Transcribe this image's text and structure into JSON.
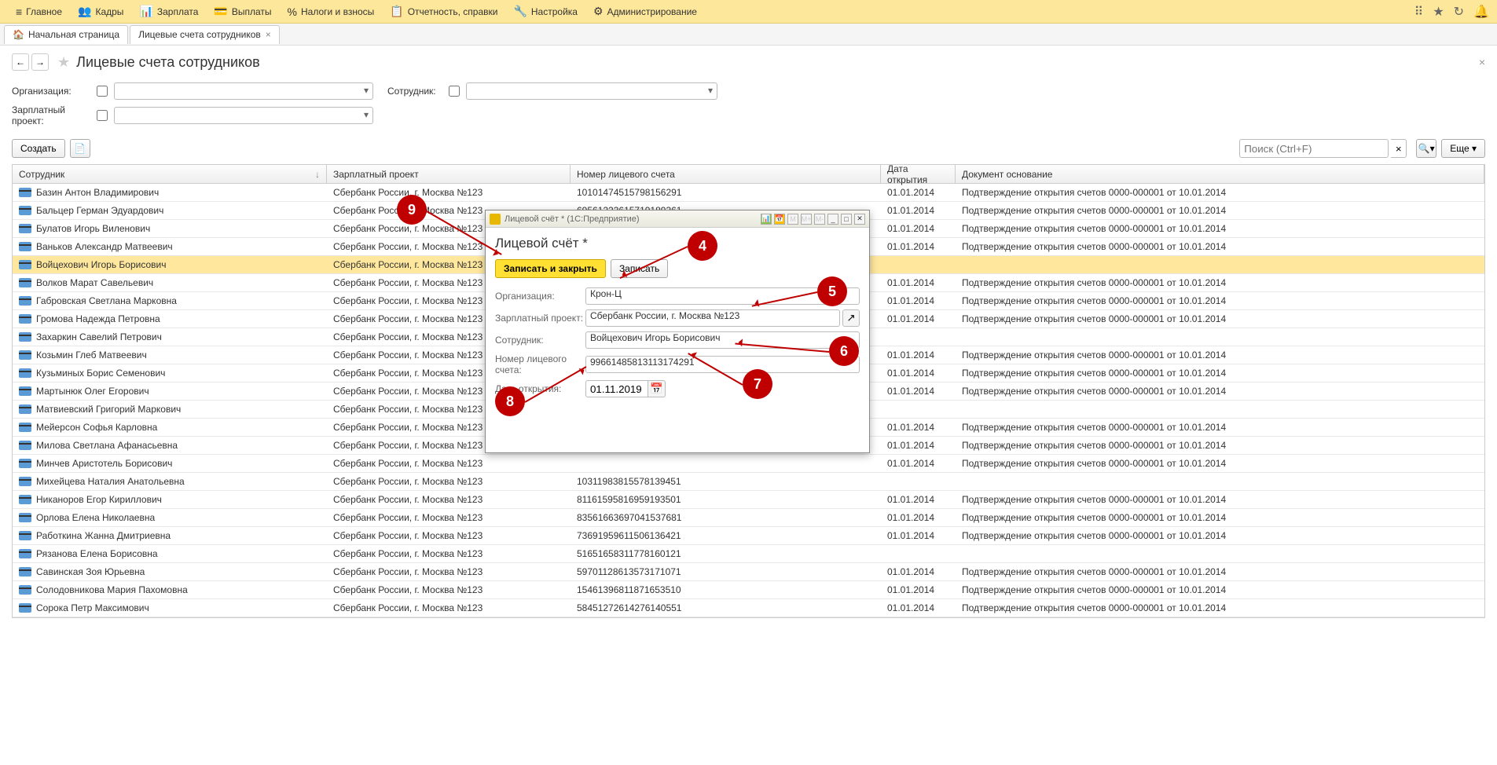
{
  "menu": {
    "items": [
      {
        "icon": "≡",
        "label": "Главное"
      },
      {
        "icon": "👥",
        "label": "Кадры"
      },
      {
        "icon": "📊",
        "label": "Зарплата"
      },
      {
        "icon": "💳",
        "label": "Выплаты"
      },
      {
        "icon": "%",
        "label": "Налоги и взносы"
      },
      {
        "icon": "📋",
        "label": "Отчетность, справки"
      },
      {
        "icon": "🔧",
        "label": "Настройка"
      },
      {
        "icon": "⚙",
        "label": "Администрирование"
      }
    ]
  },
  "tabs": {
    "home": "Начальная страница",
    "current": "Лицевые счета сотрудников"
  },
  "page": {
    "title": "Лицевые счета сотрудников"
  },
  "filters": {
    "org_label": "Организация:",
    "emp_label": "Сотрудник:",
    "proj_label": "Зарплатный проект:"
  },
  "toolbar": {
    "create": "Создать",
    "search_placeholder": "Поиск (Ctrl+F)",
    "more": "Еще"
  },
  "columns": {
    "emp": "Сотрудник",
    "proj": "Зарплатный проект",
    "acc": "Номер лицевого счета",
    "date": "Дата открытия",
    "doc": "Документ основание"
  },
  "rows": [
    {
      "emp": "Базин Антон Владимирович",
      "proj": "Сбербанк России, г. Москва №123",
      "acc": "10101474515798156291",
      "date": "01.01.2014",
      "doc": "Подтверждение открытия счетов 0000-000001 от 10.01.2014"
    },
    {
      "emp": "Бальцер Герман Эдуардович",
      "proj": "Сбербанк России, г. Москва №123",
      "acc": "69561223615719189361",
      "date": "01.01.2014",
      "doc": "Подтверждение открытия счетов 0000-000001 от 10.01.2014"
    },
    {
      "emp": "Булатов Игорь Виленович",
      "proj": "Сбербанк России, г. Москва №123",
      "acc": "",
      "date": "01.01.2014",
      "doc": "Подтверждение открытия счетов 0000-000001 от 10.01.2014"
    },
    {
      "emp": "Ваньков Александр Матвеевич",
      "proj": "Сбербанк России, г. Москва №123",
      "acc": "",
      "date": "01.01.2014",
      "doc": "Подтверждение открытия счетов 0000-000001 от 10.01.2014"
    },
    {
      "emp": "Войцехович Игорь Борисович",
      "proj": "Сбербанк России, г. Москва №123",
      "acc": "",
      "date": "",
      "doc": "",
      "selected": true
    },
    {
      "emp": "Волков Марат Савельевич",
      "proj": "Сбербанк России, г. Москва №123",
      "acc": "",
      "date": "01.01.2014",
      "doc": "Подтверждение открытия счетов 0000-000001 от 10.01.2014"
    },
    {
      "emp": "Габровская Светлана Марковна",
      "proj": "Сбербанк России, г. Москва №123",
      "acc": "",
      "date": "01.01.2014",
      "doc": "Подтверждение открытия счетов 0000-000001 от 10.01.2014"
    },
    {
      "emp": "Громова Надежда Петровна",
      "proj": "Сбербанк России, г. Москва №123",
      "acc": "",
      "date": "01.01.2014",
      "doc": "Подтверждение открытия счетов 0000-000001 от 10.01.2014"
    },
    {
      "emp": "Захаркин Савелий Петрович",
      "proj": "Сбербанк России, г. Москва №123",
      "acc": "",
      "date": "",
      "doc": ""
    },
    {
      "emp": "Козьмин Глеб Матвеевич",
      "proj": "Сбербанк России, г. Москва №123",
      "acc": "",
      "date": "01.01.2014",
      "doc": "Подтверждение открытия счетов 0000-000001 от 10.01.2014"
    },
    {
      "emp": "Кузьминых Борис Семенович",
      "proj": "Сбербанк России, г. Москва №123",
      "acc": "",
      "date": "01.01.2014",
      "doc": "Подтверждение открытия счетов 0000-000001 от 10.01.2014"
    },
    {
      "emp": "Мартынюк Олег Егорович",
      "proj": "Сбербанк России, г. Москва №123",
      "acc": "",
      "date": "01.01.2014",
      "doc": "Подтверждение открытия счетов 0000-000001 от 10.01.2014"
    },
    {
      "emp": "Матвиевский Григорий Маркович",
      "proj": "Сбербанк России, г. Москва №123",
      "acc": "",
      "date": "",
      "doc": ""
    },
    {
      "emp": "Мейерсон Софья Карловна",
      "proj": "Сбербанк России, г. Москва №123",
      "acc": "",
      "date": "01.01.2014",
      "doc": "Подтверждение открытия счетов 0000-000001 от 10.01.2014"
    },
    {
      "emp": "Милова Светлана Афанасьевна",
      "proj": "Сбербанк России, г. Москва №123",
      "acc": "",
      "date": "01.01.2014",
      "doc": "Подтверждение открытия счетов 0000-000001 от 10.01.2014"
    },
    {
      "emp": "Минчев Аристотель Борисович",
      "proj": "Сбербанк России, г. Москва №123",
      "acc": "",
      "date": "01.01.2014",
      "doc": "Подтверждение открытия счетов 0000-000001 от 10.01.2014"
    },
    {
      "emp": "Михейцева Наталия Анатольевна",
      "proj": "Сбербанк России, г. Москва №123",
      "acc": "10311983815578139451",
      "date": "",
      "doc": ""
    },
    {
      "emp": "Никаноров Егор Кириллович",
      "proj": "Сбербанк России, г. Москва №123",
      "acc": "81161595816959193501",
      "date": "01.01.2014",
      "doc": "Подтверждение открытия счетов 0000-000001 от 10.01.2014"
    },
    {
      "emp": "Орлова Елена Николаевна",
      "proj": "Сбербанк России, г. Москва №123",
      "acc": "83561663697041537681",
      "date": "01.01.2014",
      "doc": "Подтверждение открытия счетов 0000-000001 от 10.01.2014"
    },
    {
      "emp": "Работкина Жанна Дмитриевна",
      "proj": "Сбербанк России, г. Москва №123",
      "acc": "73691959611506136421",
      "date": "01.01.2014",
      "doc": "Подтверждение открытия счетов 0000-000001 от 10.01.2014"
    },
    {
      "emp": "Рязанова Елена Борисовна",
      "proj": "Сбербанк России, г. Москва №123",
      "acc": "51651658311778160121",
      "date": "",
      "doc": ""
    },
    {
      "emp": "Савинская Зоя Юрьевна",
      "proj": "Сбербанк России, г. Москва №123",
      "acc": "59701128613573171071",
      "date": "01.01.2014",
      "doc": "Подтверждение открытия счетов 0000-000001 от 10.01.2014"
    },
    {
      "emp": "Солодовникова Мария Пахомовна",
      "proj": "Сбербанк России, г. Москва №123",
      "acc": "15461396811871653510",
      "date": "01.01.2014",
      "doc": "Подтверждение открытия счетов 0000-000001 от 10.01.2014"
    },
    {
      "emp": "Сорока Петр Максимович",
      "proj": "Сбербанк России, г. Москва №123",
      "acc": "58451272614276140551",
      "date": "01.01.2014",
      "doc": "Подтверждение открытия счетов 0000-000001 от 10.01.2014"
    }
  ],
  "dialog": {
    "window_title": "Лицевой счёт * (1С:Предприятие)",
    "heading": "Лицевой счёт *",
    "save_close": "Записать и закрыть",
    "save": "Записать",
    "org_label": "Организация:",
    "org_value": "Крон-Ц",
    "proj_label": "Зарплатный проект:",
    "proj_value": "Сбербанк России, г. Москва №123",
    "emp_label": "Сотрудник:",
    "emp_value": "Войцехович Игорь Борисович",
    "acc_label": "Номер лицевого счета:",
    "acc_value": "99661485813113174291",
    "date_label": "Дата открытия:",
    "date_value": "01.11.2019"
  },
  "annotations": {
    "n4": "4",
    "n5": "5",
    "n6": "6",
    "n7": "7",
    "n8": "8",
    "n9": "9"
  }
}
